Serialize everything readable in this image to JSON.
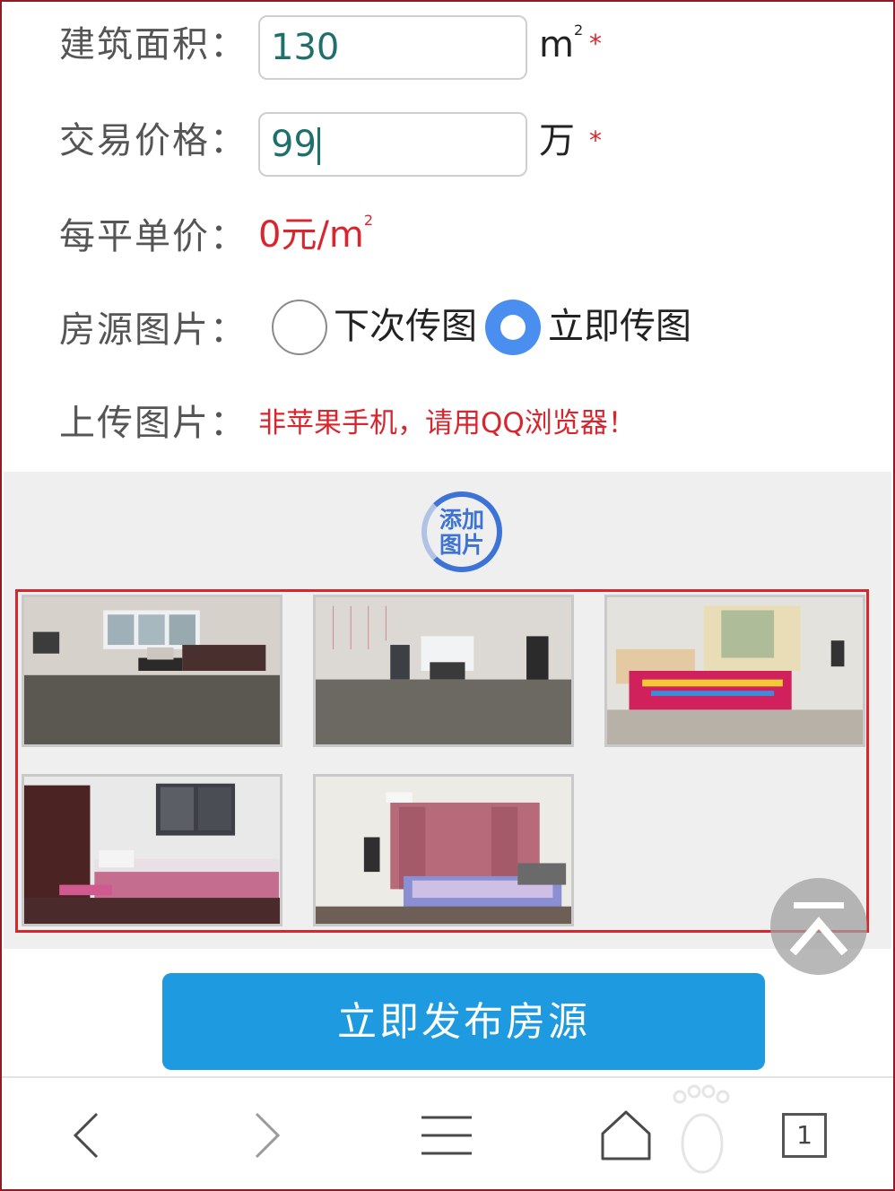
{
  "form": {
    "area": {
      "label": "建筑面积：",
      "value": "130",
      "unit": "m",
      "unit_sup": "2",
      "required": "*"
    },
    "price": {
      "label": "交易价格：",
      "value": "99",
      "unit": "万",
      "required": "*"
    },
    "unit_price": {
      "label": "每平单价：",
      "value": "0元/m",
      "value_sup": "2"
    },
    "photos_option": {
      "label": "房源图片：",
      "options": [
        {
          "label": "下次传图",
          "selected": false
        },
        {
          "label": "立即传图",
          "selected": true
        }
      ]
    },
    "upload": {
      "label": "上传图片：",
      "note": "非苹果手机，请用QQ浏览器！"
    }
  },
  "gallery": {
    "add_button_line1": "添加",
    "add_button_line2": "图片",
    "photos": [
      {
        "name": "living-room-photo"
      },
      {
        "name": "dining-area-photo"
      },
      {
        "name": "bedroom-photo-1"
      },
      {
        "name": "bedroom-photo-2"
      },
      {
        "name": "bedroom-photo-3"
      }
    ]
  },
  "actions": {
    "publish_label": "立即发布房源"
  },
  "browser_nav": {
    "icons": [
      "back-icon",
      "forward-icon",
      "menu-icon",
      "home-icon"
    ],
    "tab_count": "1"
  },
  "colors": {
    "accent_blue": "#1d9ae0",
    "radio_blue": "#4a8ff0",
    "required_red": "#d9262e",
    "frame_red": "#8f1c24"
  }
}
